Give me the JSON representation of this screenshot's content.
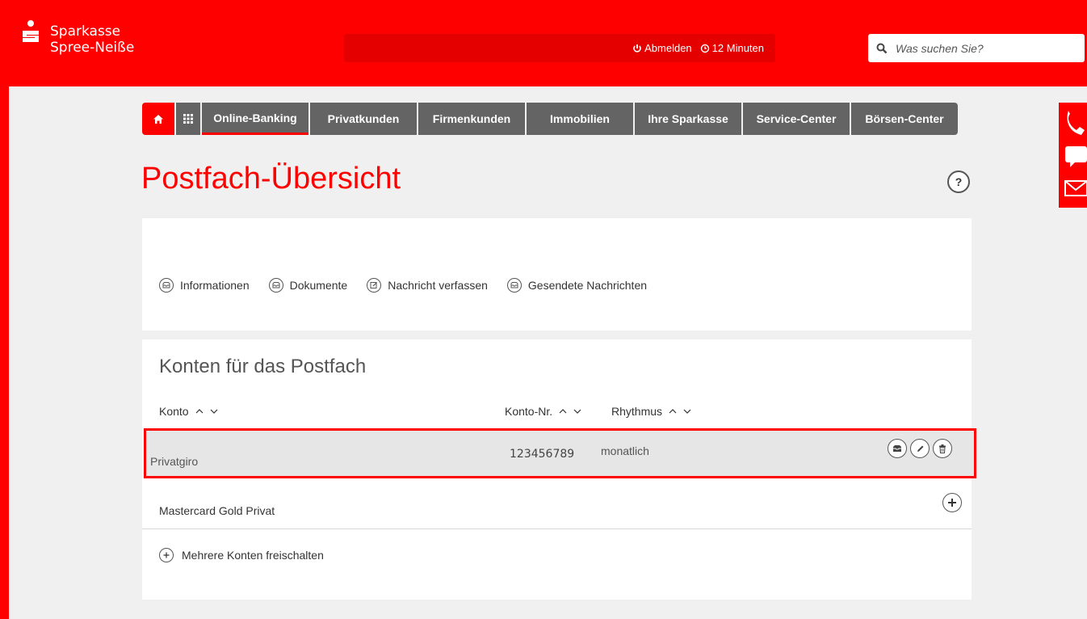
{
  "brand": {
    "line1": "Sparkasse",
    "line2": "Spree-Neiße"
  },
  "session": {
    "logout_label": "Abmelden",
    "timer_label": "12 Minuten"
  },
  "search": {
    "placeholder": "Was suchen Sie?"
  },
  "nav": {
    "items": [
      "Online-Banking",
      "Privatkunden",
      "Firmenkunden",
      "Immobilien",
      "Ihre Sparkasse",
      "Service-Center",
      "Börsen-Center"
    ]
  },
  "page": {
    "title": "Postfach-Übersicht",
    "help_label": "?"
  },
  "postfach_links": [
    "Informationen",
    "Dokumente",
    "Nachricht verfassen",
    "Gesendete Nachrichten"
  ],
  "accounts": {
    "title": "Konten für das Postfach",
    "columns": {
      "konto": "Konto",
      "konto_nr": "Konto-Nr.",
      "rhythmus": "Rhythmus"
    },
    "rows": [
      {
        "konto": "Privatgiro",
        "konto_nr": "123456789",
        "rhythmus": "monatlich"
      },
      {
        "konto": "Mastercard Gold Privat",
        "konto_nr": "",
        "rhythmus": ""
      }
    ],
    "more_label": "Mehrere Konten freischalten"
  },
  "colors": {
    "brand_red": "#ff0000",
    "nav_gray": "#646464",
    "bg": "#f0f0f0"
  }
}
